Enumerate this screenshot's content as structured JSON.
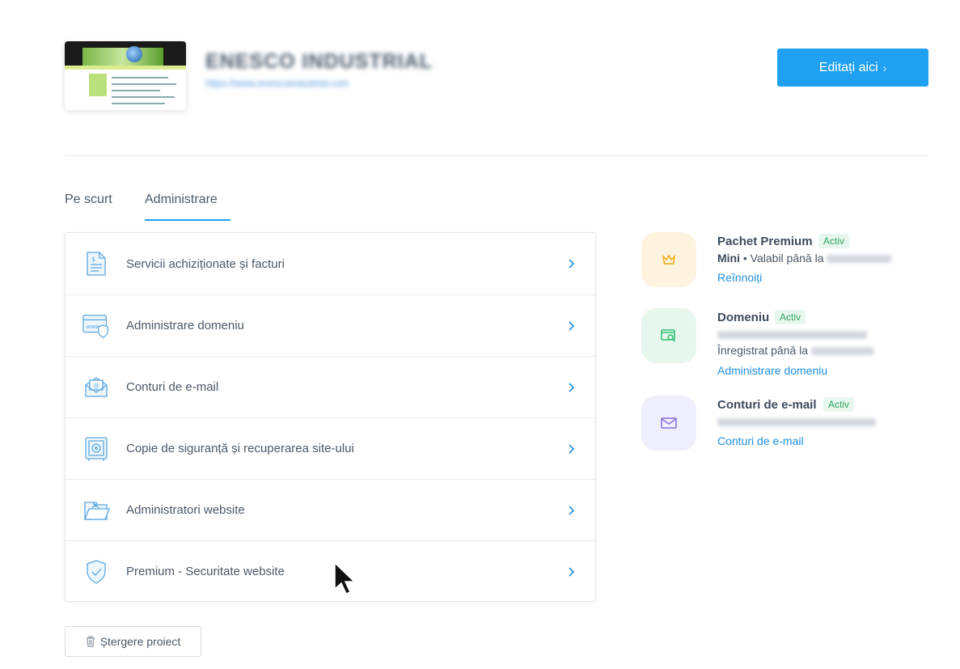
{
  "header": {
    "site_name": "ENESCO INDUSTRIAL",
    "site_url": "https://www.enescoindustrial.com",
    "edit_button": "Editați aici",
    "chevron": "›"
  },
  "tabs": [
    {
      "label": "Pe scurt",
      "active": false
    },
    {
      "label": "Administrare",
      "active": true
    }
  ],
  "menu": {
    "items": [
      {
        "label": "Servicii achiziționate și facturi",
        "icon": "invoice-icon"
      },
      {
        "label": "Administrare domeniu",
        "icon": "domain-icon"
      },
      {
        "label": "Conturi de e-mail",
        "icon": "email-icon"
      },
      {
        "label": "Copie de siguranță și recuperarea site-ului",
        "icon": "safe-icon"
      },
      {
        "label": "Administratori website",
        "icon": "folder-icon"
      },
      {
        "label": "Premium - Securitate website",
        "icon": "shield-icon"
      }
    ]
  },
  "info": {
    "package": {
      "title": "Pachet Premium",
      "badge": "Activ",
      "plan": "Mini",
      "valid_text": "• Valabil până la",
      "link": "Reînnoiți"
    },
    "domain": {
      "title": "Domeniu",
      "badge": "Activ",
      "registered_text": "Înregistrat până la",
      "link": "Administrare domeniu"
    },
    "email": {
      "title": "Conturi de e-mail",
      "badge": "Activ",
      "link": "Conturi de e-mail"
    }
  },
  "delete_button": "Ștergere proiect",
  "colors": {
    "accent": "#1fa0f0",
    "active_badge": "#2fa562",
    "crown": "#f0a818",
    "domain_icon": "#2fc070",
    "mail_icon": "#8a6ee0"
  }
}
